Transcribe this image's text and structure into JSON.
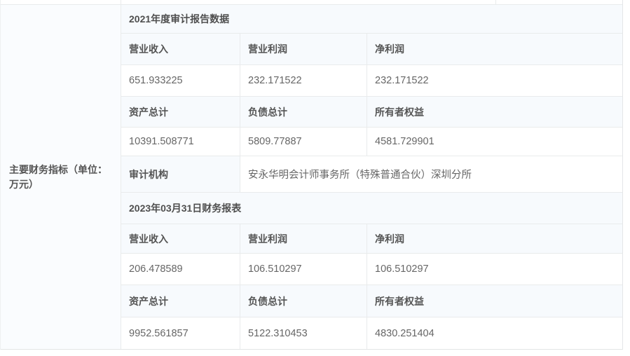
{
  "colors": {
    "row_tint": "#f7fafd",
    "label_column_bg": "#fafcfe",
    "border": "#e9ebec",
    "header_text": "#555555",
    "value_text": "#666666"
  },
  "table": {
    "row_label": "主要财务指标（单位：万元）",
    "sections": [
      {
        "title": "2021年度审计报告数据",
        "groups": [
          {
            "headers": [
              "营业收入",
              "营业利润",
              "净利润"
            ],
            "values": [
              "651.933225",
              "232.171522",
              "232.171522"
            ]
          },
          {
            "headers": [
              "资产总计",
              "负债总计",
              "所有者权益"
            ],
            "values": [
              "10391.508771",
              "5809.77887",
              "4581.729901"
            ]
          }
        ],
        "extra": {
          "label": "审计机构",
          "value": "安永华明会计师事务所（特殊普通合伙）深圳分所"
        }
      },
      {
        "title": "2023年03月31日财务报表",
        "groups": [
          {
            "headers": [
              "营业收入",
              "营业利润",
              "净利润"
            ],
            "values": [
              "206.478589",
              "106.510297",
              "106.510297"
            ]
          },
          {
            "headers": [
              "资产总计",
              "负债总计",
              "所有者权益"
            ],
            "values": [
              "9952.561857",
              "5122.310453",
              "4830.251404"
            ]
          }
        ]
      }
    ]
  }
}
